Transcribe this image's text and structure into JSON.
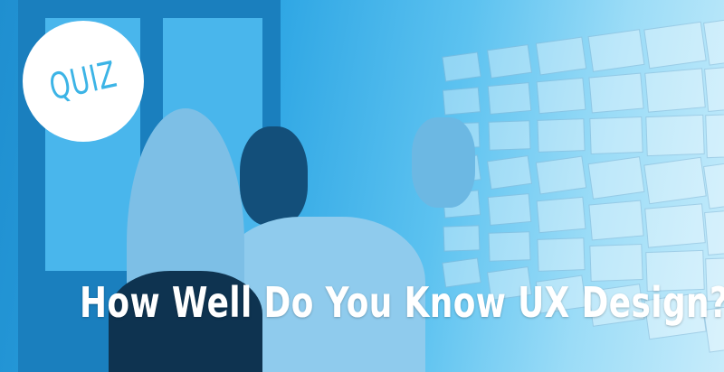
{
  "badge": {
    "label": "QUIZ",
    "color": "#3cb4e6"
  },
  "headline": "How Well Do You Know UX Design?",
  "colors": {
    "overlay": "#2ea6e4",
    "text": "#ffffff"
  }
}
